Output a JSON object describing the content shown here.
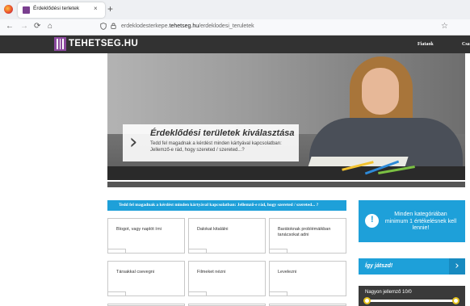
{
  "browser": {
    "tab_title": "Érdeklődési terletek",
    "close_glyph": "×",
    "new_tab_glyph": "+",
    "back_glyph": "←",
    "forward_glyph": "→",
    "reload_glyph": "⟳",
    "home_glyph": "⌂",
    "url_prefix": "erdeklodesterkepe.",
    "url_domain": "tehetseg.hu",
    "url_suffix": "/erdeklodesi_teruletek",
    "bookmark_glyph": "☆",
    "icons": [
      "firefox-logo",
      "back-icon",
      "forward-icon",
      "reload-icon",
      "home-icon",
      "shield-icon",
      "lock-icon",
      "star-icon"
    ]
  },
  "site": {
    "logo_text": "TEHETSEG.HU",
    "brand_color": "#8b4a9e",
    "nav": [
      "Fiataok",
      "Csa"
    ]
  },
  "hero": {
    "arrow": "›",
    "title": "Érdeklődési területek kiválasztása",
    "text": "Tedd fel magadnak a kérdést minden kártyával kapcsolatban: Jellemző-e rád, hogy szereted / szereted...?"
  },
  "instruction": "Tedd fel magadnak a kérdést minden kártyával kapcsolatban: Jellemző-e rád, hogy szereted / szereted... ?",
  "cards": [
    "Blogot, vagy naplót írni",
    "Dalokat kitalálni",
    "Barátoknak problémáikban tanácsokat adni",
    "Társakkal csevegni",
    "Filmeket nézni",
    "Levelezni"
  ],
  "sidebar": {
    "notice_icon": "!",
    "notice": "Minden kategóriában minimum 1 értékelésnek kell lennie!",
    "play_label": "Így játszd!",
    "play_arrow": "›",
    "rating_label": "Nagyon jellemző 10/0",
    "accent_color": "#1ea0d9",
    "knob_color": "#e5c21c"
  }
}
